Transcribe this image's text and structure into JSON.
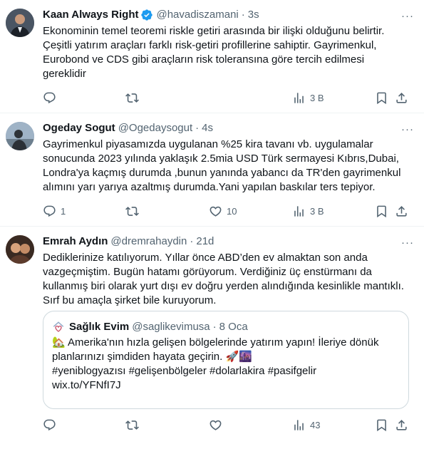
{
  "tweets": [
    {
      "name": "Kaan Always Right",
      "handle": "@havadiszamani",
      "dot": "·",
      "time": "3s",
      "more": "···",
      "text": "Ekonominin temel teoremi riskle getiri arasında bir ilişki olduğunu belirtir. Çeşitli yatırım araçları farklı risk-getiri profillerine sahiptir. Gayrimenkul, Eurobond ve CDS gibi araçların risk toleransına göre tercih edilmesi gereklidir",
      "replies": "",
      "retweets": "",
      "likes": "",
      "views": "3 B"
    },
    {
      "name": "Ogeday Sogut",
      "handle": "@Ogedaysogut",
      "dot": "·",
      "time": "4s",
      "more": "···",
      "text": "Gayrimenkul piyasamızda uygulanan %25 kira tavanı vb. uygulamalar sonucunda 2023 yılında yaklaşık 2.5mia USD Türk sermayesi Kıbrıs,Dubai, Londra'ya kaçmış durumda ,bunun yanında yabancı da TR'den gayrimenkul alımını yarı yarıya azaltmış durumda.Yani yapılan baskılar ters tepiyor.",
      "replies": "1",
      "retweets": "",
      "likes": "10",
      "views": "3 B"
    },
    {
      "name": "Emrah Aydın",
      "handle": "@dremrahaydin",
      "dot": "·",
      "time": "21d",
      "more": "···",
      "text": "Dediklerinize katılıyorum. Yıllar önce ABD’den ev almaktan son anda vazgeçmiştim. Bugün hatamı görüyorum. Verdiğiniz üç enstürmanı da kullanmış biri olarak yurt dışı ev doğru yerden alındığında kesinlikle mantıklı. Sırf bu amaçla şirket bile kuruyorum.",
      "replies": "",
      "retweets": "",
      "likes": "",
      "views": "43",
      "quote": {
        "name": "Sağlık Evim",
        "handle": "@saglikevimusa",
        "dot": "·",
        "time": "8 Oca",
        "line1": "🏡 Amerika'nın hızla gelişen bölgelerinde yatırım yapın! İleriye dönük planlarınızı şimdiden hayata geçirin. 🚀🌆",
        "line2": "#yeniblogyazısı #gelişenbölgeler #dolarlakira #pasifgelir",
        "line3": "wix.to/YFNfI7J"
      }
    }
  ],
  "colors": {
    "text": "#0f1419",
    "secondary": "#536471",
    "verified": "#1d9bf0",
    "border": "#eff3f4"
  },
  "icons": [
    "verified-badge-icon",
    "more-icon",
    "reply-icon",
    "retweet-icon",
    "like-icon",
    "views-icon",
    "bookmark-icon",
    "share-icon"
  ]
}
